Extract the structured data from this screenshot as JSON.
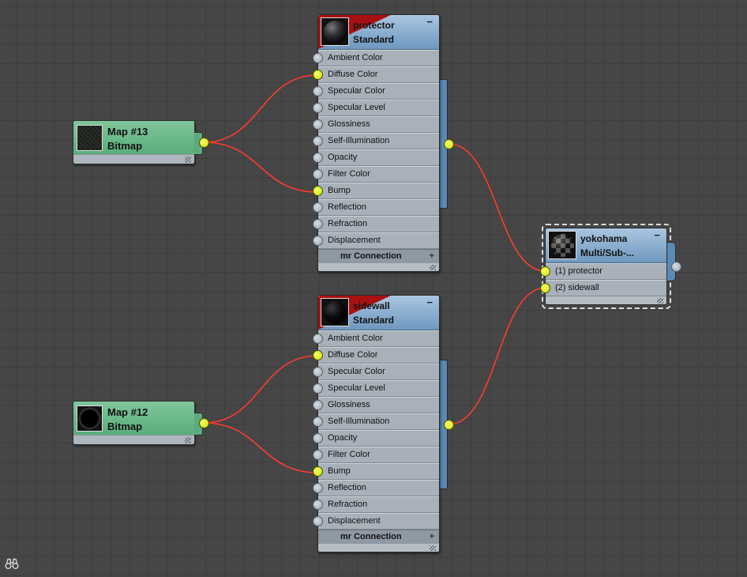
{
  "nodes": {
    "map13": {
      "name": "Map #13",
      "type": "Bitmap"
    },
    "map12": {
      "name": "Map #12",
      "type": "Bitmap"
    },
    "protector": {
      "name": "protector",
      "type": "Standard",
      "collapse": "−",
      "slots": [
        {
          "label": "Ambient Color",
          "connected": false
        },
        {
          "label": "Diffuse Color",
          "connected": true
        },
        {
          "label": "Specular Color",
          "connected": false
        },
        {
          "label": "Specular Level",
          "connected": false
        },
        {
          "label": "Glossiness",
          "connected": false
        },
        {
          "label": "Self-Illumination",
          "connected": false
        },
        {
          "label": "Opacity",
          "connected": false
        },
        {
          "label": "Filter Color",
          "connected": false
        },
        {
          "label": "Bump",
          "connected": true
        },
        {
          "label": "Reflection",
          "connected": false
        },
        {
          "label": "Refraction",
          "connected": false
        },
        {
          "label": "Displacement",
          "connected": false
        }
      ],
      "footer": "mr Connection",
      "footer_expand": "+"
    },
    "sidewall": {
      "name": "sidewall",
      "type": "Standard",
      "collapse": "−",
      "slots": [
        {
          "label": "Ambient Color",
          "connected": false
        },
        {
          "label": "Diffuse Color",
          "connected": true
        },
        {
          "label": "Specular Color",
          "connected": false
        },
        {
          "label": "Specular Level",
          "connected": false
        },
        {
          "label": "Glossiness",
          "connected": false
        },
        {
          "label": "Self-Illumination",
          "connected": false
        },
        {
          "label": "Opacity",
          "connected": false
        },
        {
          "label": "Filter Color",
          "connected": false
        },
        {
          "label": "Bump",
          "connected": true
        },
        {
          "label": "Reflection",
          "connected": false
        },
        {
          "label": "Refraction",
          "connected": false
        },
        {
          "label": "Displacement",
          "connected": false
        }
      ],
      "footer": "mr Connection",
      "footer_expand": "+"
    },
    "yokohama": {
      "name": "yokohama",
      "type": "Multi/Sub-...",
      "collapse": "−",
      "slots": [
        {
          "label": "(1) protector",
          "connected": true
        },
        {
          "label": "(2) sidewall",
          "connected": true
        }
      ]
    }
  },
  "colors": {
    "wire": "#ff3b2f",
    "socket_connected": "#d4ee00",
    "map_node": "#5fb583",
    "material_header": "#8fb3d6",
    "material_red_corner": "#a81111"
  },
  "icons": {
    "navigator": "binoculars-icon"
  }
}
